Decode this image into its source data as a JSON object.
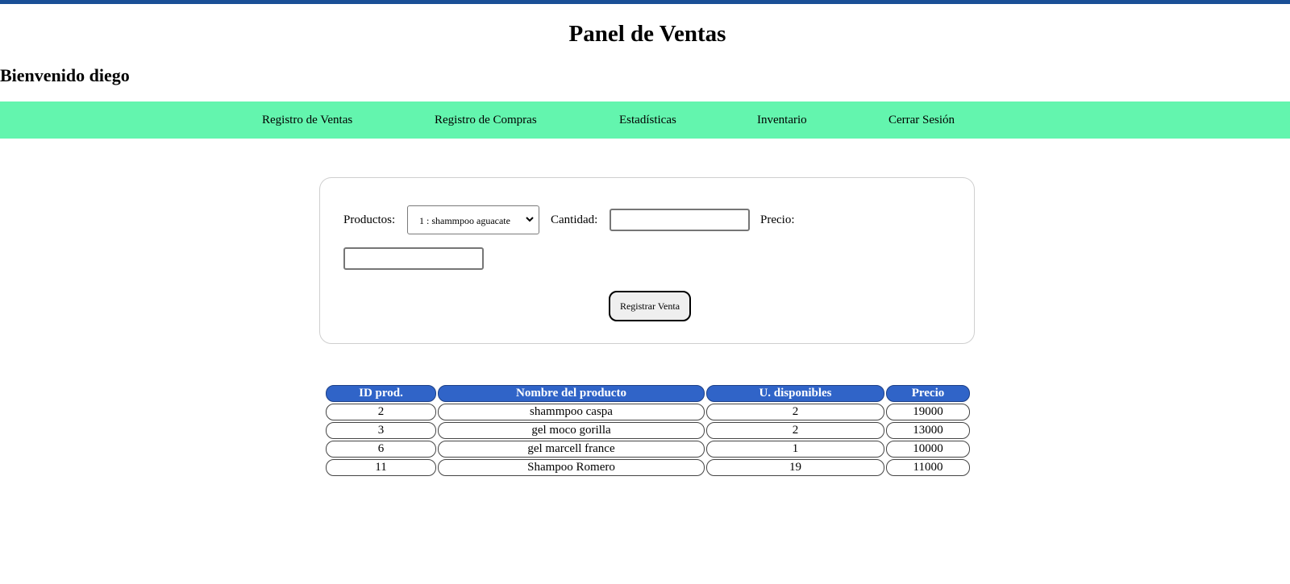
{
  "page": {
    "title": "Panel de Ventas",
    "welcome": "Bienvenido diego"
  },
  "nav": {
    "items": [
      {
        "label": "Registro de Ventas"
      },
      {
        "label": "Registro de Compras"
      },
      {
        "label": "Estadísticas"
      },
      {
        "label": "Inventario"
      },
      {
        "label": "Cerrar Sesión"
      }
    ]
  },
  "form": {
    "productos_label": "Productos:",
    "productos_selected": "1 : shammpoo aguacate",
    "cantidad_label": "Cantidad:",
    "cantidad_value": "",
    "precio_label": "Precio:",
    "precio_value": "",
    "submit_label": "Registrar Venta"
  },
  "table": {
    "headers": [
      "ID prod.",
      "Nombre del producto",
      "U. disponibles",
      "Precio"
    ],
    "rows": [
      [
        "2",
        "shammpoo caspa",
        "2",
        "19000"
      ],
      [
        "3",
        "gel moco gorilla",
        "2",
        "13000"
      ],
      [
        "6",
        "gel marcell france",
        "1",
        "10000"
      ],
      [
        "11",
        "Shampoo Romero",
        "19",
        "11000"
      ]
    ]
  },
  "colors": {
    "top_bar": "#1a4f96",
    "nav_background": "#63f5ae",
    "table_header": "#3064c8"
  },
  "icons": {
    "select_arrow": "chevron-down-icon"
  }
}
